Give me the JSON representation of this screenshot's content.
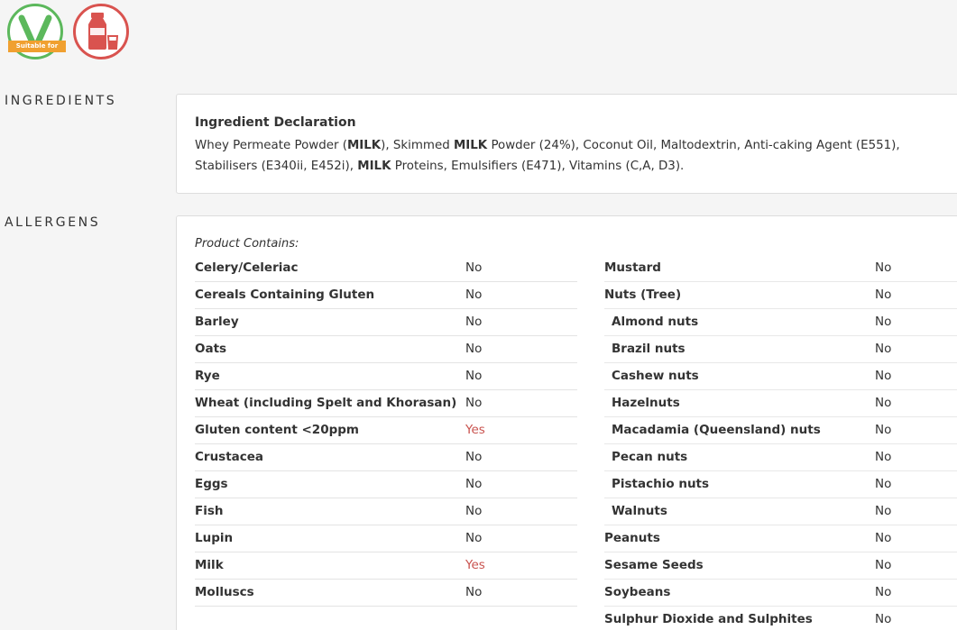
{
  "badges": {
    "vegetarian": {
      "label": "Suitable for",
      "icon": "vegetarian-icon",
      "color": "#5cb85c"
    },
    "milk": {
      "icon": "milk-bottle-icon",
      "color": "#d9534f"
    }
  },
  "ingredients": {
    "section_label": "INGREDIENTS",
    "title": "Ingredient Declaration",
    "parts": [
      {
        "t": "Whey Permeate Powder (",
        "b": false
      },
      {
        "t": "MILK",
        "b": true
      },
      {
        "t": "), Skimmed ",
        "b": false
      },
      {
        "t": "MILK",
        "b": true
      },
      {
        "t": " Powder (24%), Coconut Oil, Maltodextrin, Anti-caking Agent (E551), Stabilisers (E340ii, E452i), ",
        "b": false
      },
      {
        "t": "MILK",
        "b": true
      },
      {
        "t": " Proteins, Emulsifiers (E471), Vitamins (C,A, D3).",
        "b": false
      }
    ]
  },
  "allergens": {
    "section_label": "ALLERGENS",
    "contains_label": "Product Contains:",
    "left": [
      {
        "name": "Celery/Celeriac",
        "value": "No"
      },
      {
        "name": "Cereals Containing Gluten",
        "value": "No"
      },
      {
        "name": "Barley",
        "value": "No"
      },
      {
        "name": "Oats",
        "value": "No"
      },
      {
        "name": "Rye",
        "value": "No"
      },
      {
        "name": "Wheat (including Spelt and Khorasan)",
        "value": "No"
      },
      {
        "name": "Gluten content <20ppm",
        "value": "Yes"
      },
      {
        "name": "Crustacea",
        "value": "No"
      },
      {
        "name": "Eggs",
        "value": "No"
      },
      {
        "name": "Fish",
        "value": "No"
      },
      {
        "name": "Lupin",
        "value": "No"
      },
      {
        "name": "Milk",
        "value": "Yes"
      },
      {
        "name": "Molluscs",
        "value": "No"
      }
    ],
    "right": [
      {
        "name": "Mustard",
        "value": "No",
        "sub": false
      },
      {
        "name": "Nuts (Tree)",
        "value": "No",
        "sub": false
      },
      {
        "name": "Almond nuts",
        "value": "No",
        "sub": true
      },
      {
        "name": "Brazil nuts",
        "value": "No",
        "sub": true
      },
      {
        "name": "Cashew nuts",
        "value": "No",
        "sub": true
      },
      {
        "name": "Hazelnuts",
        "value": "No",
        "sub": true
      },
      {
        "name": "Macadamia (Queensland) nuts",
        "value": "No",
        "sub": true
      },
      {
        "name": "Pecan nuts",
        "value": "No",
        "sub": true
      },
      {
        "name": "Pistachio nuts",
        "value": "No",
        "sub": true
      },
      {
        "name": "Walnuts",
        "value": "No",
        "sub": true
      },
      {
        "name": "Peanuts",
        "value": "No",
        "sub": false
      },
      {
        "name": "Sesame Seeds",
        "value": "No",
        "sub": false
      },
      {
        "name": "Soybeans",
        "value": "No",
        "sub": false
      },
      {
        "name": "Sulphur Dioxide and Sulphites",
        "value": "No",
        "sub": false
      }
    ]
  }
}
